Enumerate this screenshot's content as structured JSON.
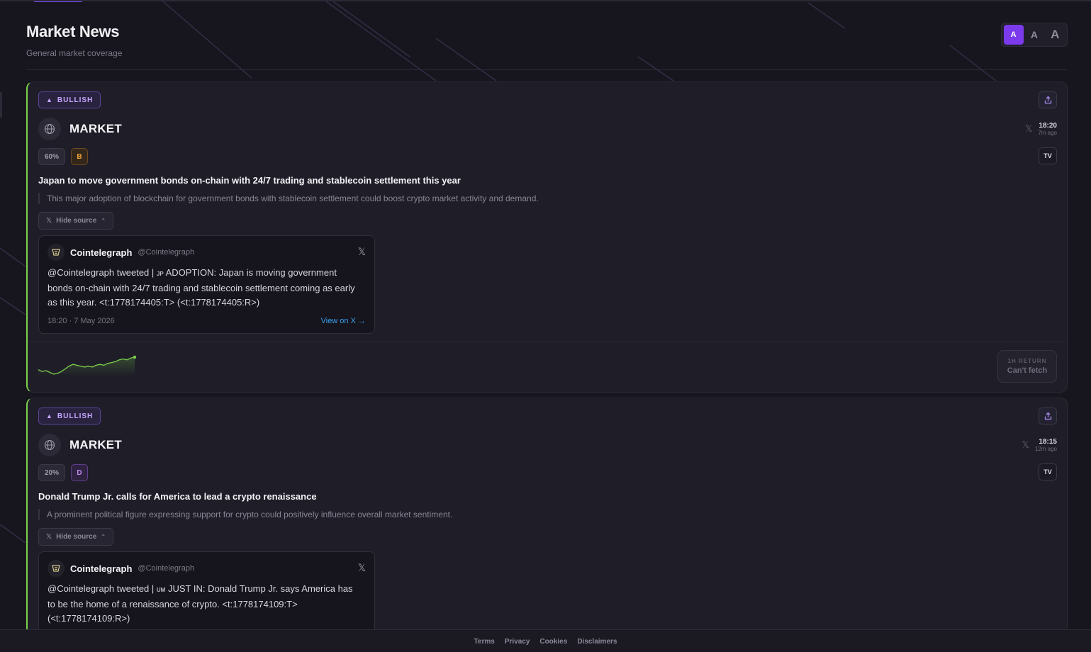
{
  "header": {
    "title": "Market News",
    "subtitle": "General market coverage"
  },
  "font_size_options": [
    "A",
    "A",
    "A"
  ],
  "cards": [
    {
      "sentiment": "BULLISH",
      "category": "MARKET",
      "time": "18:20",
      "ago": "7m ago",
      "confidence": "60%",
      "grade": "B",
      "tv_label": "TV",
      "headline": "Japan to move government bonds on-chain with 24/7 trading and stablecoin settlement this year",
      "summary": "This major adoption of blockchain for government bonds with stablecoin settlement could boost crypto market activity and demand.",
      "hide_source_label": "Hide source",
      "tweet": {
        "author": "Cointelegraph",
        "handle": "@Cointelegraph",
        "prefix": "@Cointelegraph tweeted |",
        "flag": "JP",
        "body": "ADOPTION: Japan is moving government bonds on-chain with 24/7 trading and stablecoin settlement coming as early as this year. <t:1778174405:T> (<t:1778174405:R>)",
        "date": "18:20 · 7 May 2026",
        "view_label": "View on X →"
      },
      "return_label": "1H RETURN",
      "return_value": "Can't fetch",
      "sparkline": [
        8,
        6,
        7,
        5,
        3,
        4,
        6,
        9,
        12,
        14,
        13,
        12,
        11,
        12,
        11,
        13,
        14,
        13,
        15,
        16,
        17,
        19,
        20,
        19,
        21,
        22
      ]
    },
    {
      "sentiment": "BULLISH",
      "category": "MARKET",
      "time": "18:15",
      "ago": "12m ago",
      "confidence": "20%",
      "grade": "D",
      "tv_label": "TV",
      "headline": "Donald Trump Jr. calls for America to lead a crypto renaissance",
      "summary": "A prominent political figure expressing support for crypto could positively influence overall market sentiment.",
      "hide_source_label": "Hide source",
      "tweet": {
        "author": "Cointelegraph",
        "handle": "@Cointelegraph",
        "prefix": "@Cointelegraph tweeted |",
        "flag": "UM",
        "body": "JUST IN: Donald Trump Jr. says America has to be the home of a renaissance of crypto. <t:1778174109:T> (<t:1778174109:R>)"
      }
    }
  ],
  "footer": {
    "links": [
      "Terms",
      "Privacy",
      "Cookies",
      "Disclaimers"
    ]
  },
  "colors": {
    "accent": "#7c3aed",
    "bullish_border": "#7bd04a",
    "link": "#3aa0f2"
  }
}
